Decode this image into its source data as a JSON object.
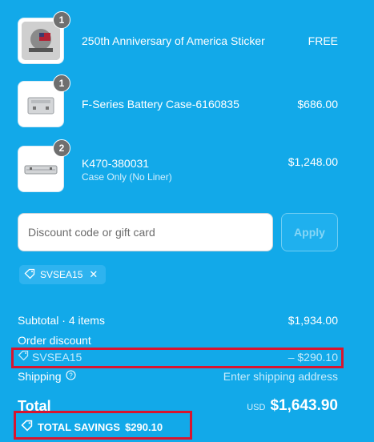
{
  "items": [
    {
      "title": "250th Anniversary of America Sticker",
      "subtitle": "",
      "price": "FREE",
      "quantity": "1",
      "image_icon": "sticker-icon"
    },
    {
      "title": "F-Series Battery Case-6160835",
      "subtitle": "",
      "price": "$686.00",
      "quantity": "1",
      "image_icon": "battery-case-icon"
    },
    {
      "title": "K470-380031",
      "subtitle": "Case Only (No Liner)",
      "price": "$1,248.00",
      "quantity": "2",
      "image_icon": "long-case-icon"
    }
  ],
  "discount": {
    "placeholder": "Discount code or gift card",
    "apply_label": "Apply",
    "applied_code": "SVSEA15"
  },
  "summary": {
    "subtotal_label": "Subtotal · 4 items",
    "subtotal_value": "$1,934.00",
    "order_discount_label": "Order discount",
    "discount_code": "SVSEA15",
    "discount_value": "– $290.10",
    "shipping_label": "Shipping",
    "shipping_hint": "Enter shipping address",
    "total_label": "Total",
    "currency": "USD",
    "total_value": "$1,643.90",
    "savings_label": "TOTAL SAVINGS",
    "savings_value": "$290.10"
  },
  "colors": {
    "background": "#12a9e9",
    "highlight": "#d8152f"
  }
}
